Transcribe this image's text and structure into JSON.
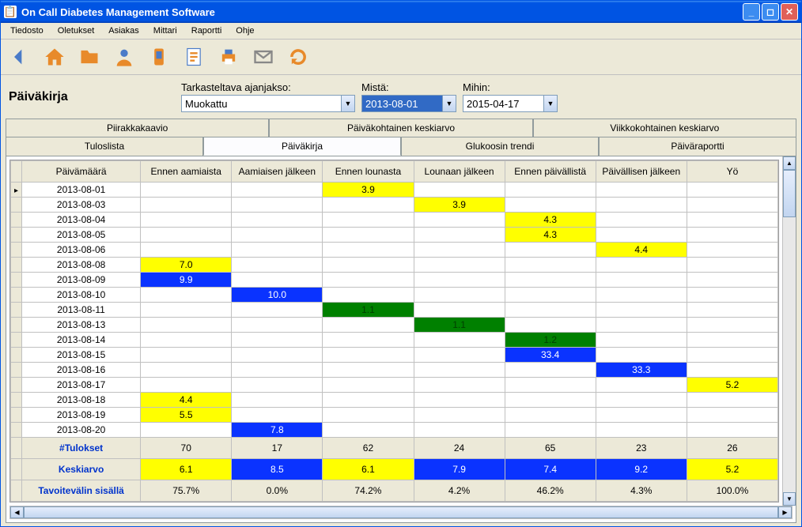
{
  "window": {
    "title": "On Call Diabetes Management Software"
  },
  "menu": [
    "Tiedosto",
    "Oletukset",
    "Asiakas",
    "Mittari",
    "Raportti",
    "Ohje"
  ],
  "toolbar_icons": [
    "back-icon",
    "home-icon",
    "folder-icon",
    "user-icon",
    "device-icon",
    "report-icon",
    "print-icon",
    "mail-icon",
    "refresh-icon"
  ],
  "page_title": "Päiväkirja",
  "controls": {
    "range_label": "Tarkasteltava ajanjakso:",
    "range_value": "Muokattu",
    "from_label": "Mistä:",
    "from_value": "2013-08-01",
    "to_label": "Mihin:",
    "to_value": "2015-04-17"
  },
  "tabs_row1": [
    "Piirakkakaavio",
    "Päiväkohtainen keskiarvo",
    "Viikkokohtainen keskiarvo"
  ],
  "tabs_row2": [
    "Tuloslista",
    "Päiväkirja",
    "Glukoosin trendi",
    "Päiväraportti"
  ],
  "active_tab": "Päiväkirja",
  "columns": [
    "Päivämäärä",
    "Ennen aamiaista",
    "Aamiaisen jälkeen",
    "Ennen lounasta",
    "Lounaan jälkeen",
    "Ennen päivällistä",
    "Päivällisen jälkeen",
    "Yö"
  ],
  "rows": [
    {
      "date": "2013-08-01",
      "cells": [
        null,
        null,
        {
          "v": "3.9",
          "c": "yellow"
        },
        null,
        null,
        null,
        null
      ]
    },
    {
      "date": "2013-08-03",
      "cells": [
        null,
        null,
        null,
        {
          "v": "3.9",
          "c": "yellow"
        },
        null,
        null,
        null
      ]
    },
    {
      "date": "2013-08-04",
      "cells": [
        null,
        null,
        null,
        null,
        {
          "v": "4.3",
          "c": "yellow"
        },
        null,
        null
      ]
    },
    {
      "date": "2013-08-05",
      "cells": [
        null,
        null,
        null,
        null,
        {
          "v": "4.3",
          "c": "yellow"
        },
        null,
        null
      ]
    },
    {
      "date": "2013-08-06",
      "cells": [
        null,
        null,
        null,
        null,
        null,
        {
          "v": "4.4",
          "c": "yellow"
        },
        null
      ]
    },
    {
      "date": "2013-08-08",
      "cells": [
        {
          "v": "7.0",
          "c": "yellow"
        },
        null,
        null,
        null,
        null,
        null,
        null
      ]
    },
    {
      "date": "2013-08-09",
      "cells": [
        {
          "v": "9.9",
          "c": "blue"
        },
        null,
        null,
        null,
        null,
        null,
        null
      ]
    },
    {
      "date": "2013-08-10",
      "cells": [
        null,
        {
          "v": "10.0",
          "c": "blue"
        },
        null,
        null,
        null,
        null,
        null
      ]
    },
    {
      "date": "2013-08-11",
      "cells": [
        null,
        null,
        {
          "v": "1.1",
          "c": "green"
        },
        null,
        null,
        null,
        null
      ]
    },
    {
      "date": "2013-08-13",
      "cells": [
        null,
        null,
        null,
        {
          "v": "1.1",
          "c": "green"
        },
        null,
        null,
        null
      ]
    },
    {
      "date": "2013-08-14",
      "cells": [
        null,
        null,
        null,
        null,
        {
          "v": "1.2",
          "c": "green"
        },
        null,
        null
      ]
    },
    {
      "date": "2013-08-15",
      "cells": [
        null,
        null,
        null,
        null,
        {
          "v": "33.4",
          "c": "blue"
        },
        null,
        null
      ]
    },
    {
      "date": "2013-08-16",
      "cells": [
        null,
        null,
        null,
        null,
        null,
        {
          "v": "33.3",
          "c": "blue"
        },
        null
      ]
    },
    {
      "date": "2013-08-17",
      "cells": [
        null,
        null,
        null,
        null,
        null,
        null,
        {
          "v": "5.2",
          "c": "yellow"
        }
      ]
    },
    {
      "date": "2013-08-18",
      "cells": [
        {
          "v": "4.4",
          "c": "yellow"
        },
        null,
        null,
        null,
        null,
        null,
        null
      ]
    },
    {
      "date": "2013-08-19",
      "cells": [
        {
          "v": "5.5",
          "c": "yellow"
        },
        null,
        null,
        null,
        null,
        null,
        null
      ]
    },
    {
      "date": "2013-08-20",
      "cells": [
        null,
        {
          "v": "7.8",
          "c": "blue"
        },
        null,
        null,
        null,
        null,
        null
      ]
    }
  ],
  "summary": {
    "results_label": "#Tulokset",
    "results": [
      "70",
      "17",
      "62",
      "24",
      "65",
      "23",
      "26"
    ],
    "avg_label": "Keskiarvo",
    "avg": [
      {
        "v": "6.1",
        "c": "yellow"
      },
      {
        "v": "8.5",
        "c": "blue"
      },
      {
        "v": "6.1",
        "c": "yellow"
      },
      {
        "v": "7.9",
        "c": "blue"
      },
      {
        "v": "7.4",
        "c": "blue"
      },
      {
        "v": "9.2",
        "c": "blue"
      },
      {
        "v": "5.2",
        "c": "yellow"
      }
    ],
    "inrange_label": "Tavoitevälin sisällä",
    "inrange": [
      "75.7%",
      "0.0%",
      "74.2%",
      "4.2%",
      "46.2%",
      "4.3%",
      "100.0%"
    ]
  }
}
